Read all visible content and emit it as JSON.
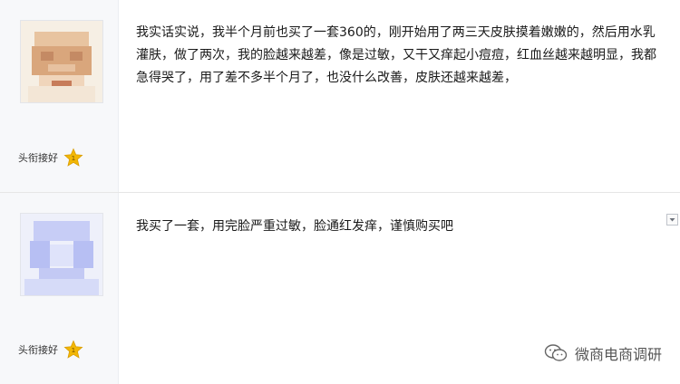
{
  "posts": [
    {
      "rank_label": "头衔接好",
      "content": "我实话实说，我半个月前也买了一套360的，刚开始用了两三天皮肤摸着嫩嫩的，然后用水乳灌肤，做了两次，我的脸越来越差，像是过敏，又干又痒起小痘痘，红血丝越来越明显，我都急得哭了，用了差不多半个月了，也没什么改善，皮肤还越来越差，"
    },
    {
      "rank_label": "头衔接好",
      "content": "我买了一套，用完脸严重过敏，脸通红发痒，谨慎购买吧"
    }
  ],
  "watermark": {
    "text": "微商电商调研"
  },
  "icons": {
    "star": "star-badge-icon",
    "dropdown": "chevron-down-icon",
    "watermark": "wechat-logo-icon"
  },
  "colors": {
    "star": "#f2b705",
    "author_bg": "#f7f8fa",
    "text": "#1a1a1a"
  }
}
